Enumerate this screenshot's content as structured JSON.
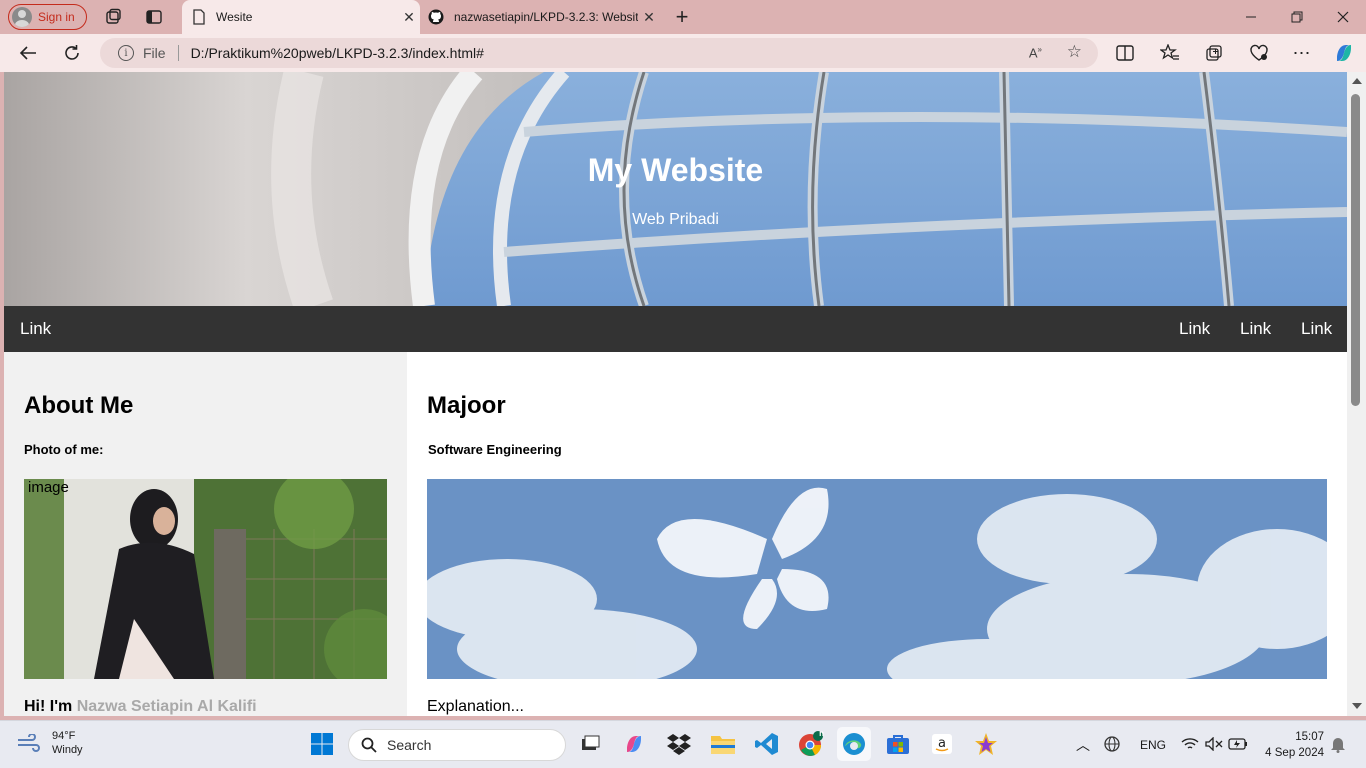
{
  "browser": {
    "profile_label": "Sign in",
    "tabs": [
      {
        "title": "Wesite",
        "active": true
      },
      {
        "title": "nazwasetiapin/LKPD-3.2.3: Websit",
        "active": false
      }
    ],
    "new_tab_symbol": "+",
    "url_prefix": "File",
    "url": "D:/Praktikum%20pweb/LKPD-3.2.3/index.html#"
  },
  "page": {
    "header": {
      "title": "My Website",
      "subtitle": "Web Pribadi"
    },
    "nav": {
      "left_link": "Link",
      "right_links": [
        "Link",
        "Link",
        "Link"
      ]
    },
    "left_column": {
      "heading": "About Me",
      "photo_label": "Photo of me:",
      "image_alt": "image",
      "intro_prefix": "Hi! I'm",
      "intro_name": "Nazwa Setiapin Al Kalifi"
    },
    "right_column": {
      "heading": "Majoor",
      "subheading": "Software Engineering",
      "explanation": "Explanation..."
    }
  },
  "taskbar": {
    "weather_temp": "94°F",
    "weather_desc": "Windy",
    "search_placeholder": "Search",
    "language": "ENG",
    "time": "15:07",
    "date": "4 Sep 2024",
    "chrome_badge": "n"
  },
  "colors": {
    "tabbar_bg": "#dcb2b2",
    "nav_bg": "#333333",
    "left_col_bg": "#f1f1f1",
    "name_color": "#a9a9a9",
    "signin_red": "#c42b1c"
  }
}
